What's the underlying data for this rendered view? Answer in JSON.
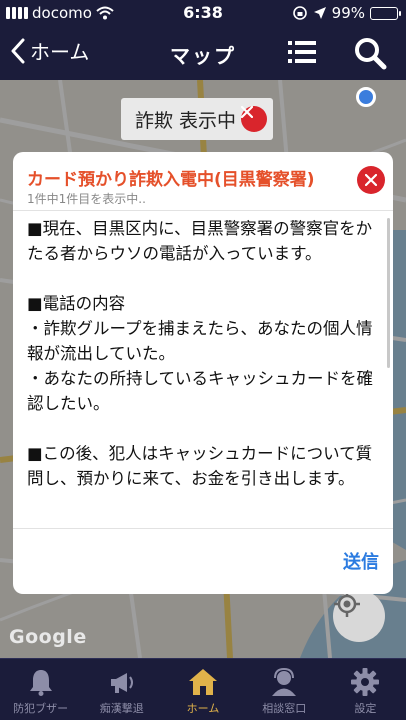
{
  "status_bar": {
    "carrier": "docomo",
    "time": "6:38",
    "battery": "99%"
  },
  "nav": {
    "back_label": "ホーム",
    "title": "マップ"
  },
  "map": {
    "filter_chip": "詐欺 表示中",
    "google_logo": "Google"
  },
  "dialog": {
    "title": "カード預かり詐欺入電中(目黒警察署)",
    "subtitle": "1件中1件目を表示中..",
    "paragraphs": [
      "■現在、目黒区内に、目黒警察署の警察官をかたる者からウソの電話が入っています。",
      "■電話の内容\n・詐欺グループを捕まえたら、あなたの個人情報が流出していた。\n・あなたの所持しているキャッシュカードを確認したい。",
      "■この後、犯人はキャッシュカードについて質問し、預かりに来て、お金を引き出します。"
    ],
    "send_label": "送信"
  },
  "tabs": [
    {
      "label": "防犯ブザー",
      "icon": "bell-icon"
    },
    {
      "label": "痴漢撃退",
      "icon": "megaphone-icon"
    },
    {
      "label": "ホーム",
      "icon": "home-icon"
    },
    {
      "label": "相談窓口",
      "icon": "operator-icon"
    },
    {
      "label": "設定",
      "icon": "gear-icon"
    }
  ],
  "colors": {
    "nav_background": "#1b1c3a",
    "dialog_title": "#e5502a",
    "close_button": "#d9252c",
    "send_button": "#2b7be0",
    "active_tab": "#e0b24a"
  }
}
